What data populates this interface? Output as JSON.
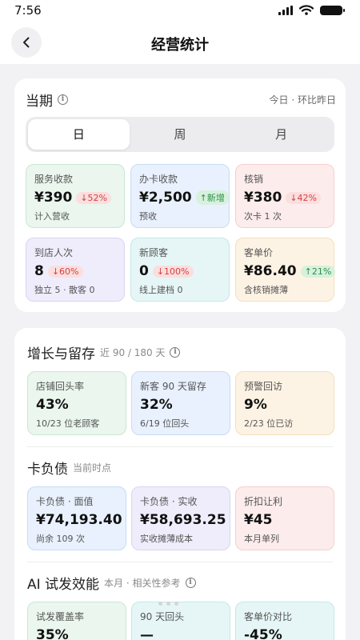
{
  "status": {
    "time": "7:56"
  },
  "nav": {
    "title": "经营统计"
  },
  "current": {
    "title": "当期",
    "note": "今日 · 环比昨日",
    "tabs": [
      "日",
      "周",
      "月"
    ],
    "tiles": [
      {
        "label": "服务收款",
        "value": "¥390",
        "badge": "↓52%",
        "trend": "down",
        "note": "计入营收"
      },
      {
        "label": "办卡收款",
        "value": "¥2,500",
        "badge": "↑新增",
        "trend": "up",
        "note": "预收"
      },
      {
        "label": "核销",
        "value": "¥380",
        "badge": "↓42%",
        "trend": "down",
        "note": "次卡 1 次"
      },
      {
        "label": "到店人次",
        "value": "8",
        "badge": "↓60%",
        "trend": "down",
        "note": "独立 5 · 散客 0"
      },
      {
        "label": "新顾客",
        "value": "0",
        "badge": "↓100%",
        "trend": "down",
        "note": "线上建档 0"
      },
      {
        "label": "客单价",
        "value": "¥86.40",
        "badge": "↑21%",
        "trend": "up",
        "note": "含核销摊薄"
      }
    ]
  },
  "growth": {
    "title": "增长与留存",
    "sub": "近 90 / 180 天",
    "tiles": [
      {
        "label": "店铺回头率",
        "value": "43%",
        "note": "10/23 位老顾客"
      },
      {
        "label": "新客 90 天留存",
        "value": "32%",
        "note": "6/19 位回头"
      },
      {
        "label": "预警回访",
        "value": "9%",
        "note": "2/23 位已访"
      }
    ]
  },
  "debt": {
    "title": "卡负债",
    "sub": "当前时点",
    "tiles": [
      {
        "label": "卡负债 · 面值",
        "value": "¥74,193.40",
        "note": "尚余 109 次"
      },
      {
        "label": "卡负债 · 实收",
        "value": "¥58,693.25",
        "note": "实收摊薄成本"
      },
      {
        "label": "折扣让利",
        "value": "¥45",
        "note": "本月单列"
      }
    ]
  },
  "ai": {
    "title": "AI 试发效能",
    "sub": "本月 · 相关性参考",
    "tiles": [
      {
        "label": "试发覆盖率",
        "value": "35%"
      },
      {
        "label": "90 天回头",
        "value": "—"
      },
      {
        "label": "客单价对比",
        "value": "-45%"
      }
    ]
  },
  "colors": {
    "up": "#2f8f47",
    "down": "#d43f3f",
    "background": "#f2f2f4"
  }
}
